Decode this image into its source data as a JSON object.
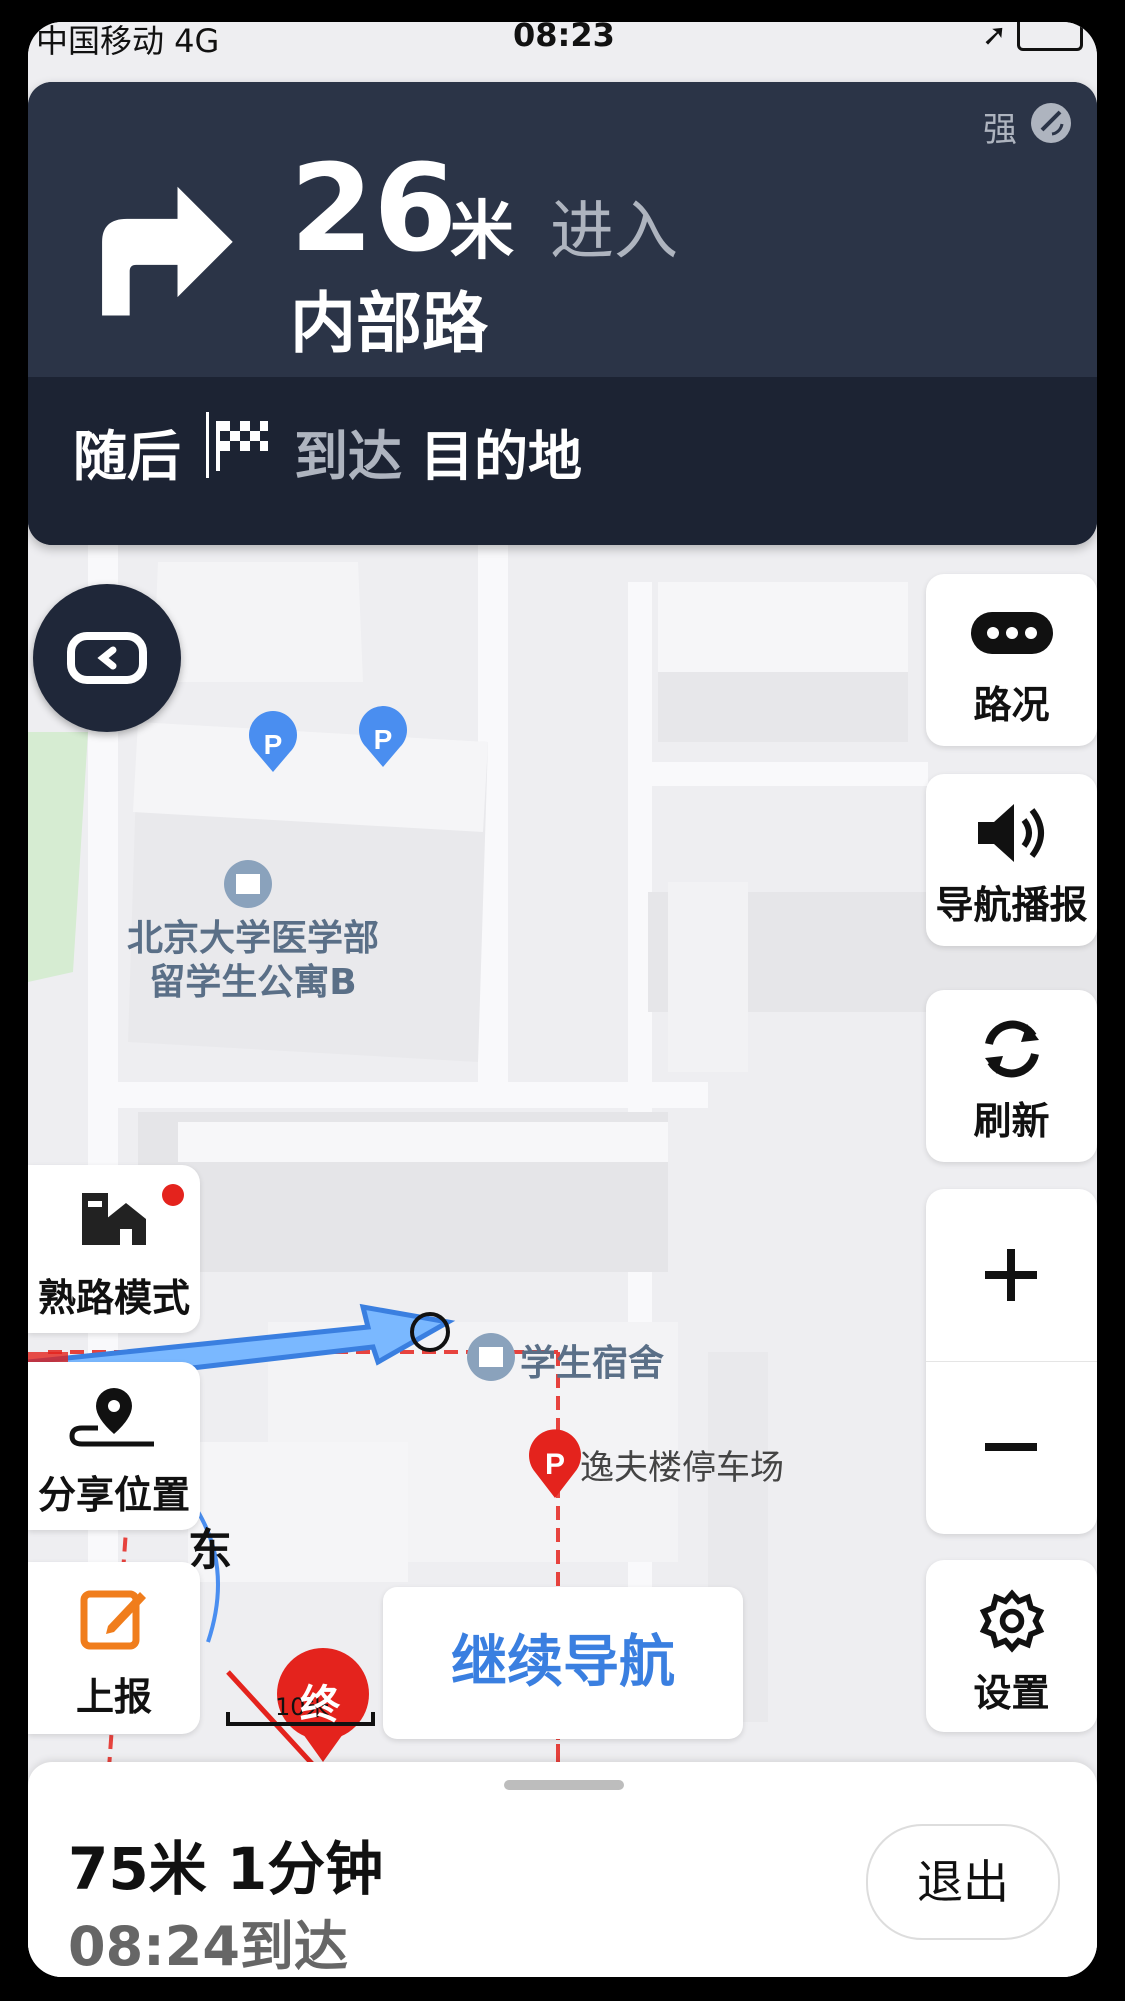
{
  "status_bar": {
    "carrier": "中国移动  4G",
    "time": "08:23"
  },
  "nav_card": {
    "turn_icon": "turn-right-arrow-icon",
    "distance": "26",
    "unit": "米",
    "action": "进入",
    "road": "内部路",
    "gps_strength": "强",
    "then_label": "随后",
    "then_icon": "checkered-flag-icon",
    "arrive_label": "到达",
    "destination": "目的地"
  },
  "right_buttons": {
    "traffic": "路况",
    "voice": "导航播报",
    "refresh": "刷新",
    "settings": "设置"
  },
  "left_buttons": {
    "familiar_mode": "熟路模式",
    "share_location": "分享位置",
    "report": "上报"
  },
  "map_labels": {
    "building_line1": "北京大学医学部",
    "building_line2": "留学生公寓B",
    "dorm": "学生宿舍",
    "parking": "逸夫楼停车场",
    "east": "东",
    "scale": "10米",
    "end_marker": "终"
  },
  "resume_button": "继续导航",
  "bottom_panel": {
    "summary": "75米 1分钟",
    "eta": "08:24到达",
    "exit": "退出"
  },
  "colors": {
    "nav_bg": "#2b3447",
    "accent_blue": "#3a7fe0",
    "route_red": "#e4231d"
  }
}
